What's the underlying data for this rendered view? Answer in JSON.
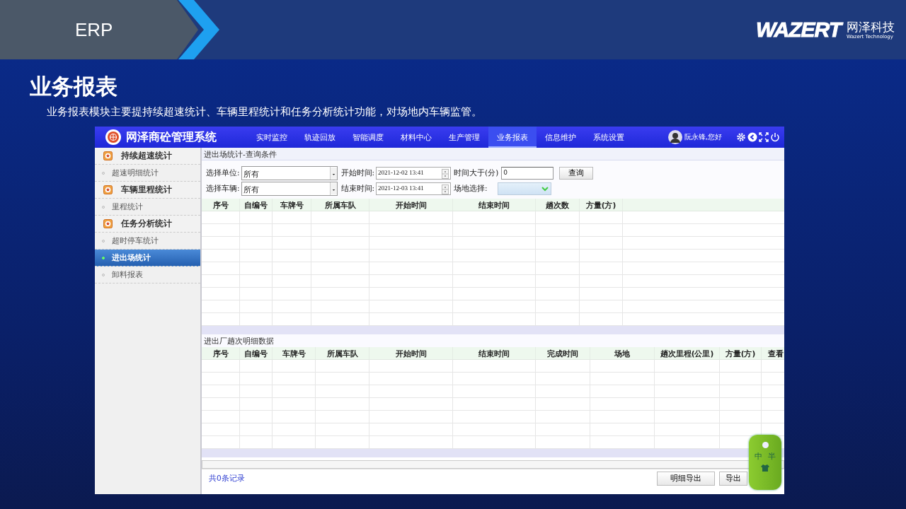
{
  "slide": {
    "section": "ERP",
    "brand": {
      "wordmark": "WAZERT",
      "name": "网泽科技",
      "tagline": "Wazert Technology"
    },
    "title": "业务报表",
    "description": "业务报表模块主要提持续超速统计、车辆里程统计和任务分析统计功能，对场地内车辆监管。"
  },
  "app": {
    "title": "网泽商砼管理系统",
    "nav": [
      {
        "label": "实时监控",
        "selected": false
      },
      {
        "label": "轨迹回放",
        "selected": false
      },
      {
        "label": "智能调度",
        "selected": false
      },
      {
        "label": "材料中心",
        "selected": false
      },
      {
        "label": "生产管理",
        "selected": false
      },
      {
        "label": "业务报表",
        "selected": true
      },
      {
        "label": "信息维护",
        "selected": false
      },
      {
        "label": "系统设置",
        "selected": false
      }
    ],
    "user": "阮永锋,您好",
    "sidebar": [
      {
        "label": "持续超速统计",
        "children": [
          {
            "label": "超速明细统计",
            "selected": false
          }
        ]
      },
      {
        "label": "车辆里程统计",
        "children": [
          {
            "label": "里程统计",
            "selected": false
          }
        ]
      },
      {
        "label": "任务分析统计",
        "children": [
          {
            "label": "超时停车统计",
            "selected": false
          },
          {
            "label": "进出场统计",
            "selected": true
          },
          {
            "label": "卸料报表",
            "selected": false
          }
        ]
      }
    ],
    "query": {
      "title": "进出场统计-查询条件",
      "rows": [
        [
          {
            "kind": "select",
            "label": "选择单位:",
            "value": "所有"
          },
          {
            "kind": "datetime",
            "label": "开始时间:",
            "value": "2021-12-02 13:41"
          },
          {
            "kind": "text",
            "label": "时间大于(分)",
            "value": "0"
          },
          {
            "kind": "button",
            "label": "查询"
          }
        ],
        [
          {
            "kind": "select",
            "label": "选择车辆:",
            "value": "所有"
          },
          {
            "kind": "datetime",
            "label": "结束时间:",
            "value": "2021-12-03 13:41"
          },
          {
            "kind": "combo",
            "label": "场地选择:"
          }
        ]
      ]
    },
    "grid1": {
      "columns": [
        "序号",
        "自编号",
        "车牌号",
        "所属车队",
        "开始时间",
        "结束时间",
        "趟次数",
        "方量(方)"
      ]
    },
    "detail": {
      "title": "进出厂趟次明细数据",
      "columns": [
        "序号",
        "自编号",
        "车牌号",
        "所属车队",
        "开始时间",
        "结束时间",
        "完成时间",
        "场地",
        "趟次里程(公里)",
        "方量(方)",
        "查看"
      ]
    },
    "footer": {
      "count": "共0条记录",
      "buttons": [
        "明细导出",
        "导出"
      ]
    },
    "ime": {
      "chars": [
        "中",
        "半"
      ]
    }
  }
}
